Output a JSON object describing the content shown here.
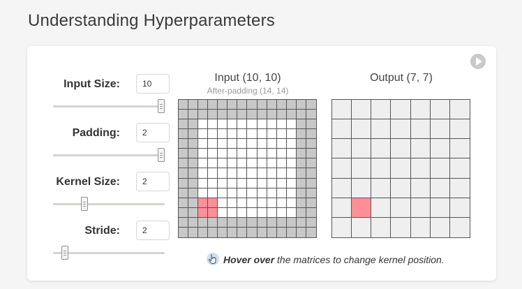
{
  "page": {
    "title": "Understanding Hyperparameters"
  },
  "controls": [
    {
      "id": "input-size",
      "label": "Input Size:",
      "value": "10",
      "fraction": 1.0
    },
    {
      "id": "padding",
      "label": "Padding:",
      "value": "2",
      "fraction": 1.0
    },
    {
      "id": "kernel-size",
      "label": "Kernel Size:",
      "value": "2",
      "fraction": 0.25
    },
    {
      "id": "stride",
      "label": "Stride:",
      "value": "2",
      "fraction": 0.0
    }
  ],
  "input_matrix": {
    "title": "Input (10, 10)",
    "subtitle": "After-padding (14, 14)",
    "grid_size": 14,
    "padding": 2,
    "kernel": {
      "row": 10,
      "col": 2,
      "size": 2
    },
    "colors": {
      "padding": "#c8c8c8",
      "cell": "#ffffff",
      "kernel": "#ff8f97",
      "line": "#555555"
    }
  },
  "output_matrix": {
    "title": "Output (7, 7)",
    "grid_size": 7,
    "highlight": {
      "row": 5,
      "col": 1
    },
    "colors": {
      "cell": "#efefef",
      "highlight": "#ff8f97",
      "line": "#555555"
    }
  },
  "hint": {
    "bold": "Hover over",
    "rest": " the matrices to change kernel position.",
    "icon": "hand-pointer-icon"
  },
  "icons": {
    "play": "play-icon"
  }
}
